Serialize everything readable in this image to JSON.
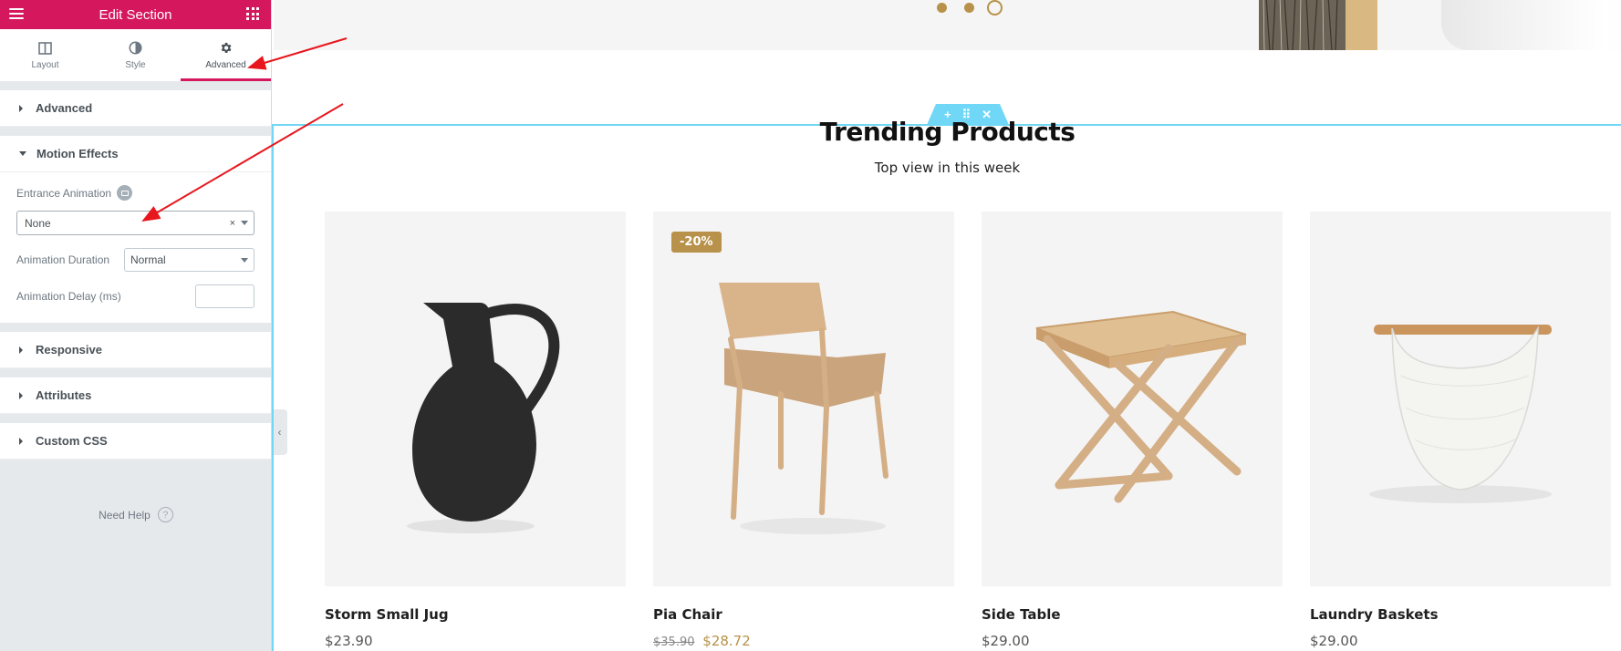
{
  "panel": {
    "header_title": "Edit Section",
    "tabs": [
      {
        "label": "Layout",
        "icon": "layout-icon"
      },
      {
        "label": "Style",
        "icon": "style-icon"
      },
      {
        "label": "Advanced",
        "icon": "gear-icon",
        "active": true
      }
    ],
    "sections": {
      "advanced": "Advanced",
      "motion": "Motion Effects",
      "responsive": "Responsive",
      "attributes": "Attributes",
      "custom_css": "Custom CSS"
    },
    "controls": {
      "entrance_label": "Entrance Animation",
      "entrance_value": "None",
      "entrance_clear": "×",
      "duration_label": "Animation Duration",
      "duration_value": "Normal",
      "delay_label": "Animation Delay (ms)",
      "delay_value": ""
    },
    "need_help": "Need Help",
    "help_glyph": "?",
    "accent": "#d5185e"
  },
  "canvas": {
    "section_handle": {
      "add": "+",
      "move": "⠿",
      "close": "✕"
    },
    "collapse_glyph": "‹",
    "heading": "Trending Products",
    "subheading": "Top view in this week",
    "gold": "#b8924a",
    "products": [
      {
        "name": "Storm Small Jug",
        "price": "$23.90"
      },
      {
        "name": "Pia Chair",
        "badge": "-20%",
        "old_price": "$35.90",
        "price": "$28.72"
      },
      {
        "name": "Side Table",
        "price": "$29.00"
      },
      {
        "name": "Laundry Baskets",
        "price": "$29.00"
      }
    ]
  }
}
